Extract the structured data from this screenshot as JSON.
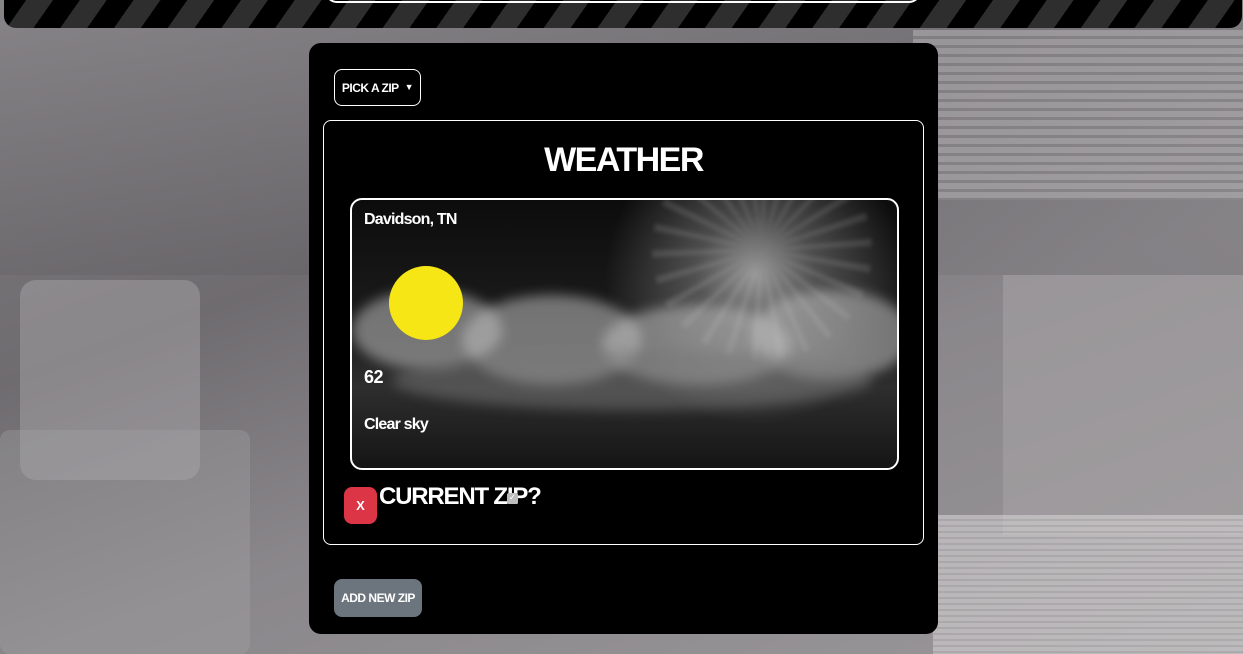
{
  "header": {
    "zip_dropdown_label": "PICK A ZIP"
  },
  "weather": {
    "title": "WEATHER",
    "location": "Davidson, TN",
    "icon": "sun-icon",
    "temperature": "62",
    "condition": "Clear sky",
    "remove_label": "X",
    "current_zip_label": "CURRENT ZIP?",
    "current_zip_checked": true
  },
  "actions": {
    "add_zip_label": "ADD NEW ZIP"
  },
  "colors": {
    "panel_bg": "#000000",
    "sun": "#f6e615",
    "remove_button": "#dc3545",
    "add_button": "#6c757d"
  }
}
